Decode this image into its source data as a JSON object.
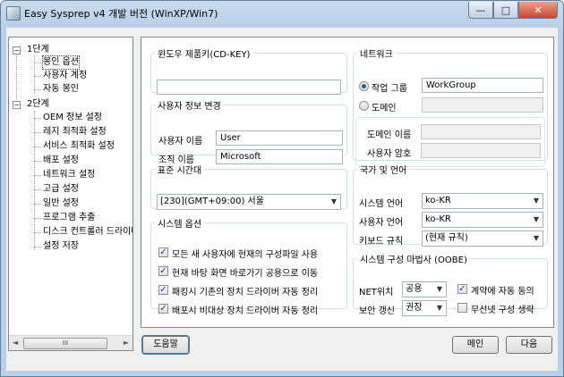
{
  "window": {
    "title": "Easy Sysprep v4 개발 버전 (WinXP/Win7)",
    "min_glyph": "—",
    "max_glyph": "□",
    "close_glyph": "✕"
  },
  "tree": {
    "groups": [
      {
        "label": "1단계",
        "expander": "−",
        "items": [
          "봉인 옵션",
          "사용자 계정",
          "자동 봉인"
        ]
      },
      {
        "label": "2단계",
        "expander": "−",
        "items": [
          "OEM 정보 설정",
          "레지 최적화 설정",
          "서비스 최적화 설정",
          "배포 설정",
          "네트워크 설정",
          "고급 설정",
          "일반 설정",
          "프로그램 추출",
          "디스크 컨트롤러 드라이버",
          "설정 저장"
        ]
      }
    ],
    "selected": "봉인 옵션",
    "scroll": {
      "left": "◄",
      "right": "►",
      "thumb": "III"
    }
  },
  "cdkey": {
    "legend": "윈도우 제품키(CD-KEY)",
    "value": ""
  },
  "userinfo": {
    "legend": "사용자 정보 변경",
    "name_label": "사용자 이름",
    "name_value": "User",
    "org_label": "조직 이름",
    "org_value": "Microsoft"
  },
  "timezone": {
    "legend": "표준 시간대",
    "value": "[230](GMT+09:00) 서울"
  },
  "sysopts": {
    "legend": "시스템 옵션",
    "items": [
      {
        "label": "모든 새 사용자에 현재의 구성파일 사용",
        "checked": true
      },
      {
        "label": "현재 바탕 화면 바로가기 공용으로 이동",
        "checked": true
      },
      {
        "label": "패킹시 기존의 장치 드라이버 자동 정리",
        "checked": true
      },
      {
        "label": "배포시 비대상 장치 드라이버 자동 정리",
        "checked": true
      }
    ]
  },
  "network": {
    "legend": "네트워크",
    "workgroup_label": "작업 그룹",
    "workgroup_value": "WorkGroup",
    "workgroup_selected": true,
    "domain_label": "도메인",
    "domain_value": "",
    "domain_name_label": "도메인 이름",
    "domain_pwd_label": "사용자 암호"
  },
  "locale": {
    "legend": "국가 및 언어",
    "system_label": "시스템 언어",
    "system_value": "ko-KR",
    "user_label": "사용자 언어",
    "user_value": "ko-KR",
    "keyboard_label": "키보드 규칙",
    "keyboard_value": "(현재 규칙)"
  },
  "oobe": {
    "legend": "시스템 구성 마법사 (OOBE)",
    "netpos_label": "NET위치",
    "netpos_value": "공용",
    "update_label": "보안 갱신",
    "update_value": "권장",
    "eula_label": "계약에 자동 동의",
    "eula_checked": true,
    "wireless_label": "무선넷 구성 생략",
    "wireless_checked": false
  },
  "buttons": {
    "help": "도움말",
    "main": "메인",
    "next": "다음"
  },
  "check_glyph": "✓",
  "arrow_glyph": "▼"
}
